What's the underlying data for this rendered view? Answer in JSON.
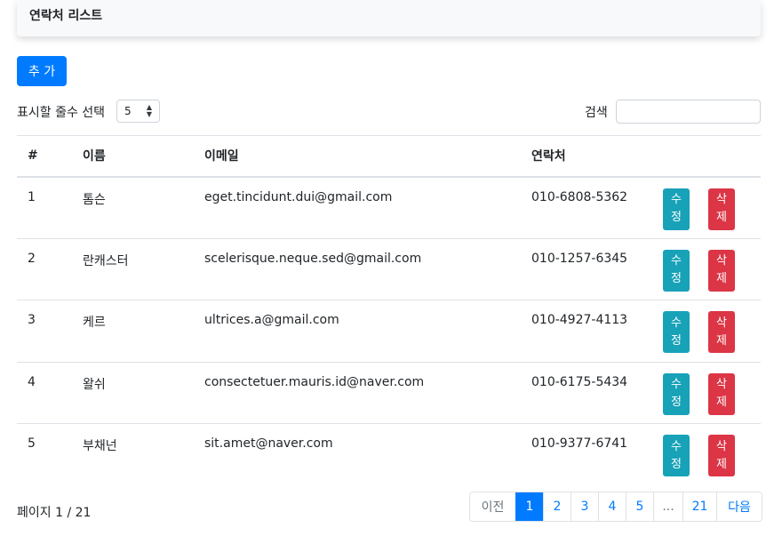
{
  "header": {
    "title": "연락처 리스트"
  },
  "toolbar": {
    "add_label": "추 가",
    "page_size_label": "표시할 줄수 선택",
    "page_size_value": "5",
    "search_label": "검색",
    "search_value": ""
  },
  "table": {
    "columns": [
      "#",
      "이름",
      "이메일",
      "연락처",
      ""
    ],
    "rows": [
      {
        "num": "1",
        "name": "톰슨",
        "email": "eget.tincidunt.dui@gmail.com",
        "phone": "010-6808-5362",
        "edit": "수정",
        "delete": "삭제"
      },
      {
        "num": "2",
        "name": "란캐스터",
        "email": "scelerisque.neque.sed@gmail.com",
        "phone": "010-1257-6345",
        "edit": "수정",
        "delete": "삭제"
      },
      {
        "num": "3",
        "name": "케르",
        "email": "ultrices.a@gmail.com",
        "phone": "010-4927-4113",
        "edit": "수정",
        "delete": "삭제"
      },
      {
        "num": "4",
        "name": "왈쉬",
        "email": "consectetuer.mauris.id@naver.com",
        "phone": "010-6175-5434",
        "edit": "수정",
        "delete": "삭제"
      },
      {
        "num": "5",
        "name": "부채넌",
        "email": "sit.amet@naver.com",
        "phone": "010-9377-6741",
        "edit": "수정",
        "delete": "삭제"
      }
    ]
  },
  "footer": {
    "page_info": "페이지 1 / 21",
    "pagination": {
      "prev": "이전",
      "pages": [
        "1",
        "2",
        "3",
        "4",
        "5",
        "...",
        "21"
      ],
      "current": "1",
      "next": "다음"
    }
  },
  "colors": {
    "primary": "#007bff",
    "edit": "#17a2b8",
    "delete": "#dc3545"
  }
}
